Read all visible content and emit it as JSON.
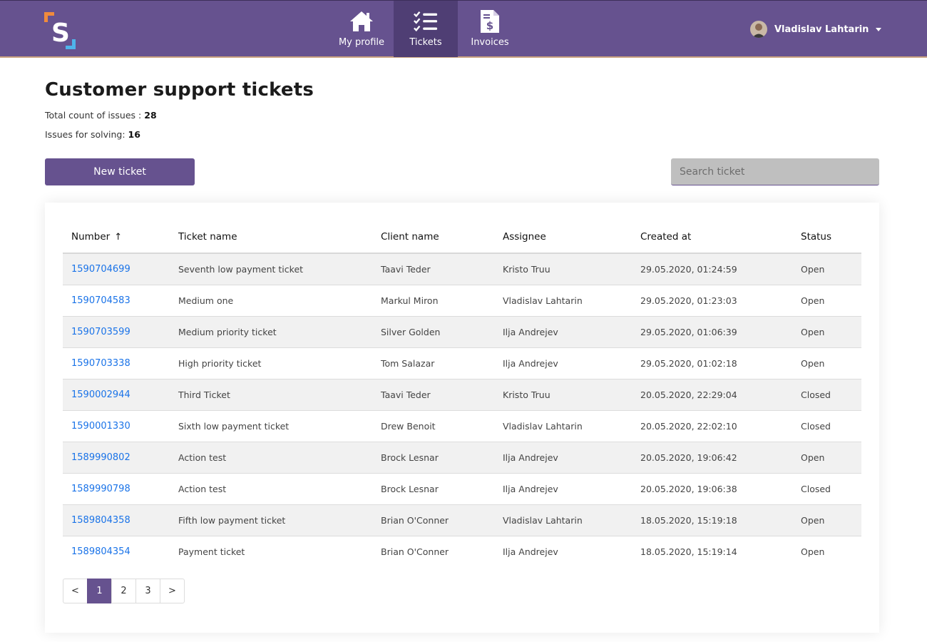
{
  "nav": {
    "items": [
      {
        "label": "My profile",
        "icon": "home-icon",
        "active": false
      },
      {
        "label": "Tickets",
        "icon": "checklist-icon",
        "active": true
      },
      {
        "label": "Invoices",
        "icon": "invoice-icon",
        "active": false
      }
    ],
    "user": {
      "name": "Vladislav Lahtarin"
    }
  },
  "page": {
    "title": "Customer support tickets",
    "total_label": "Total count of issues :",
    "total_value": "28",
    "solving_label": "Issues for solving:",
    "solving_value": "16",
    "new_ticket_label": "New ticket",
    "search_placeholder": "Search ticket"
  },
  "table": {
    "headers": [
      "Number",
      "Ticket name",
      "Client name",
      "Assignee",
      "Created at",
      "Status"
    ],
    "sort_indicator": "↑",
    "rows": [
      {
        "number": "1590704699",
        "name": "Seventh low payment ticket",
        "client": "Taavi Teder",
        "assignee": "Kristo Truu",
        "created": "29.05.2020, 01:24:59",
        "status": "Open"
      },
      {
        "number": "1590704583",
        "name": "Medium one",
        "client": "Markul Miron",
        "assignee": "Vladislav Lahtarin",
        "created": "29.05.2020, 01:23:03",
        "status": "Open"
      },
      {
        "number": "1590703599",
        "name": "Medium priority ticket",
        "client": "Silver Golden",
        "assignee": "Ilja Andrejev",
        "created": "29.05.2020, 01:06:39",
        "status": "Open"
      },
      {
        "number": "1590703338",
        "name": "High priority ticket",
        "client": "Tom Salazar",
        "assignee": "Ilja Andrejev",
        "created": "29.05.2020, 01:02:18",
        "status": "Open"
      },
      {
        "number": "1590002944",
        "name": "Third Ticket",
        "client": "Taavi Teder",
        "assignee": "Kristo Truu",
        "created": "20.05.2020, 22:29:04",
        "status": "Closed"
      },
      {
        "number": "1590001330",
        "name": "Sixth low payment ticket",
        "client": "Drew Benoit",
        "assignee": "Vladislav Lahtarin",
        "created": "20.05.2020, 22:02:10",
        "status": "Closed"
      },
      {
        "number": "1589990802",
        "name": "Action test",
        "client": "Brock Lesnar",
        "assignee": "Ilja Andrejev",
        "created": "20.05.2020, 19:06:42",
        "status": "Open"
      },
      {
        "number": "1589990798",
        "name": "Action test",
        "client": "Brock Lesnar",
        "assignee": "Ilja Andrejev",
        "created": "20.05.2020, 19:06:38",
        "status": "Closed"
      },
      {
        "number": "1589804358",
        "name": "Fifth low payment ticket",
        "client": "Brian O'Conner",
        "assignee": "Vladislav Lahtarin",
        "created": "18.05.2020, 15:19:18",
        "status": "Open"
      },
      {
        "number": "1589804354",
        "name": "Payment ticket",
        "client": "Brian O'Conner",
        "assignee": "Ilja Andrejev",
        "created": "18.05.2020, 15:19:14",
        "status": "Open"
      }
    ]
  },
  "pagination": {
    "prev": "<",
    "pages": [
      "1",
      "2",
      "3"
    ],
    "current": "1",
    "next": ">"
  },
  "colors": {
    "accent": "#66528f",
    "link": "#1a73e8",
    "logo_orange": "#f08a3c",
    "logo_blue": "#4fb3ea"
  }
}
